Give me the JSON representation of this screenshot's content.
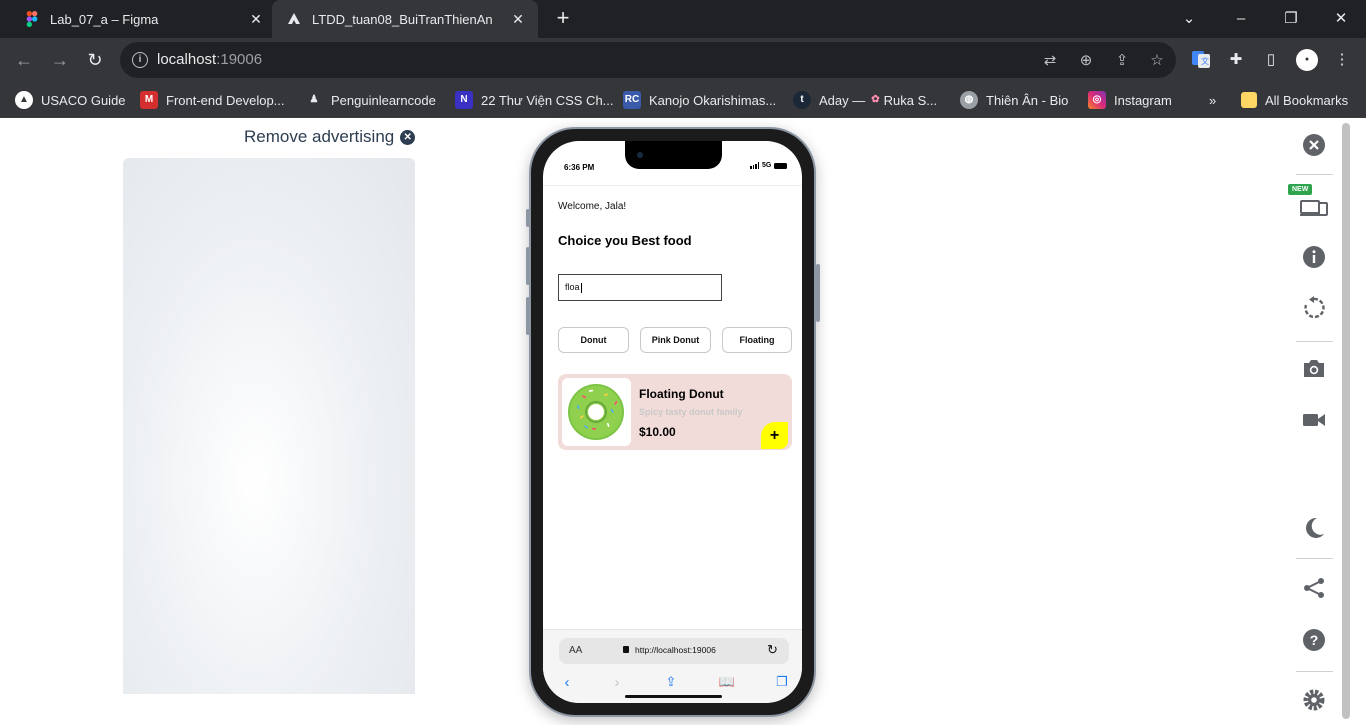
{
  "browser": {
    "tabs": [
      {
        "title": "Lab_07_a – Figma",
        "icon": "figma-icon",
        "active": false
      },
      {
        "title": "LTDD_tuan08_BuiTranThienAn",
        "icon": "expo-icon",
        "active": true
      }
    ],
    "url_host": "localhost",
    "url_port": ":19006",
    "bookmarks": [
      {
        "label": "USACO Guide",
        "icon": "usaco-icon"
      },
      {
        "label": "Front-end Develop...",
        "icon": "m-logo-icon"
      },
      {
        "label": "Penguinlearncode",
        "icon": "penguin-icon"
      },
      {
        "label": "22 Thư Viện CSS Ch...",
        "icon": "n-logo-icon"
      },
      {
        "label": "Kanojo Okarishimas...",
        "icon": "rc-logo-icon"
      },
      {
        "label": "Aday —",
        "icon": "tumblr-icon"
      },
      {
        "label": "Ruka S...",
        "icon": "sakura-icon"
      },
      {
        "label": "Thiên Ân - Bio",
        "icon": "globe-icon"
      },
      {
        "label": "Instagram",
        "icon": "instagram-icon"
      }
    ],
    "more_bookmarks": "»",
    "all_bookmarks": "All Bookmarks"
  },
  "page": {
    "remove_ad": "Remove advertising"
  },
  "phone": {
    "status_time": "6:36 PM",
    "status_network": "5G",
    "welcome": "Welcome, Jala!",
    "headline": "Choice you Best food",
    "search_value": "floa",
    "chips": [
      "Donut",
      "Pink Donut",
      "Floating"
    ],
    "card": {
      "name": "Floating Donut",
      "description": "Spicy tasty donut family",
      "price": "$10.00",
      "add_label": "+"
    },
    "safari": {
      "aa": "AA",
      "url": "http://localhost:19006"
    }
  },
  "colors": {
    "card_bg": "#f2dcda",
    "add_button": "#ffff00",
    "chrome_dark": "#202124",
    "chrome_toolbar": "#35363a"
  },
  "rail": {
    "new_badge": "NEW"
  }
}
